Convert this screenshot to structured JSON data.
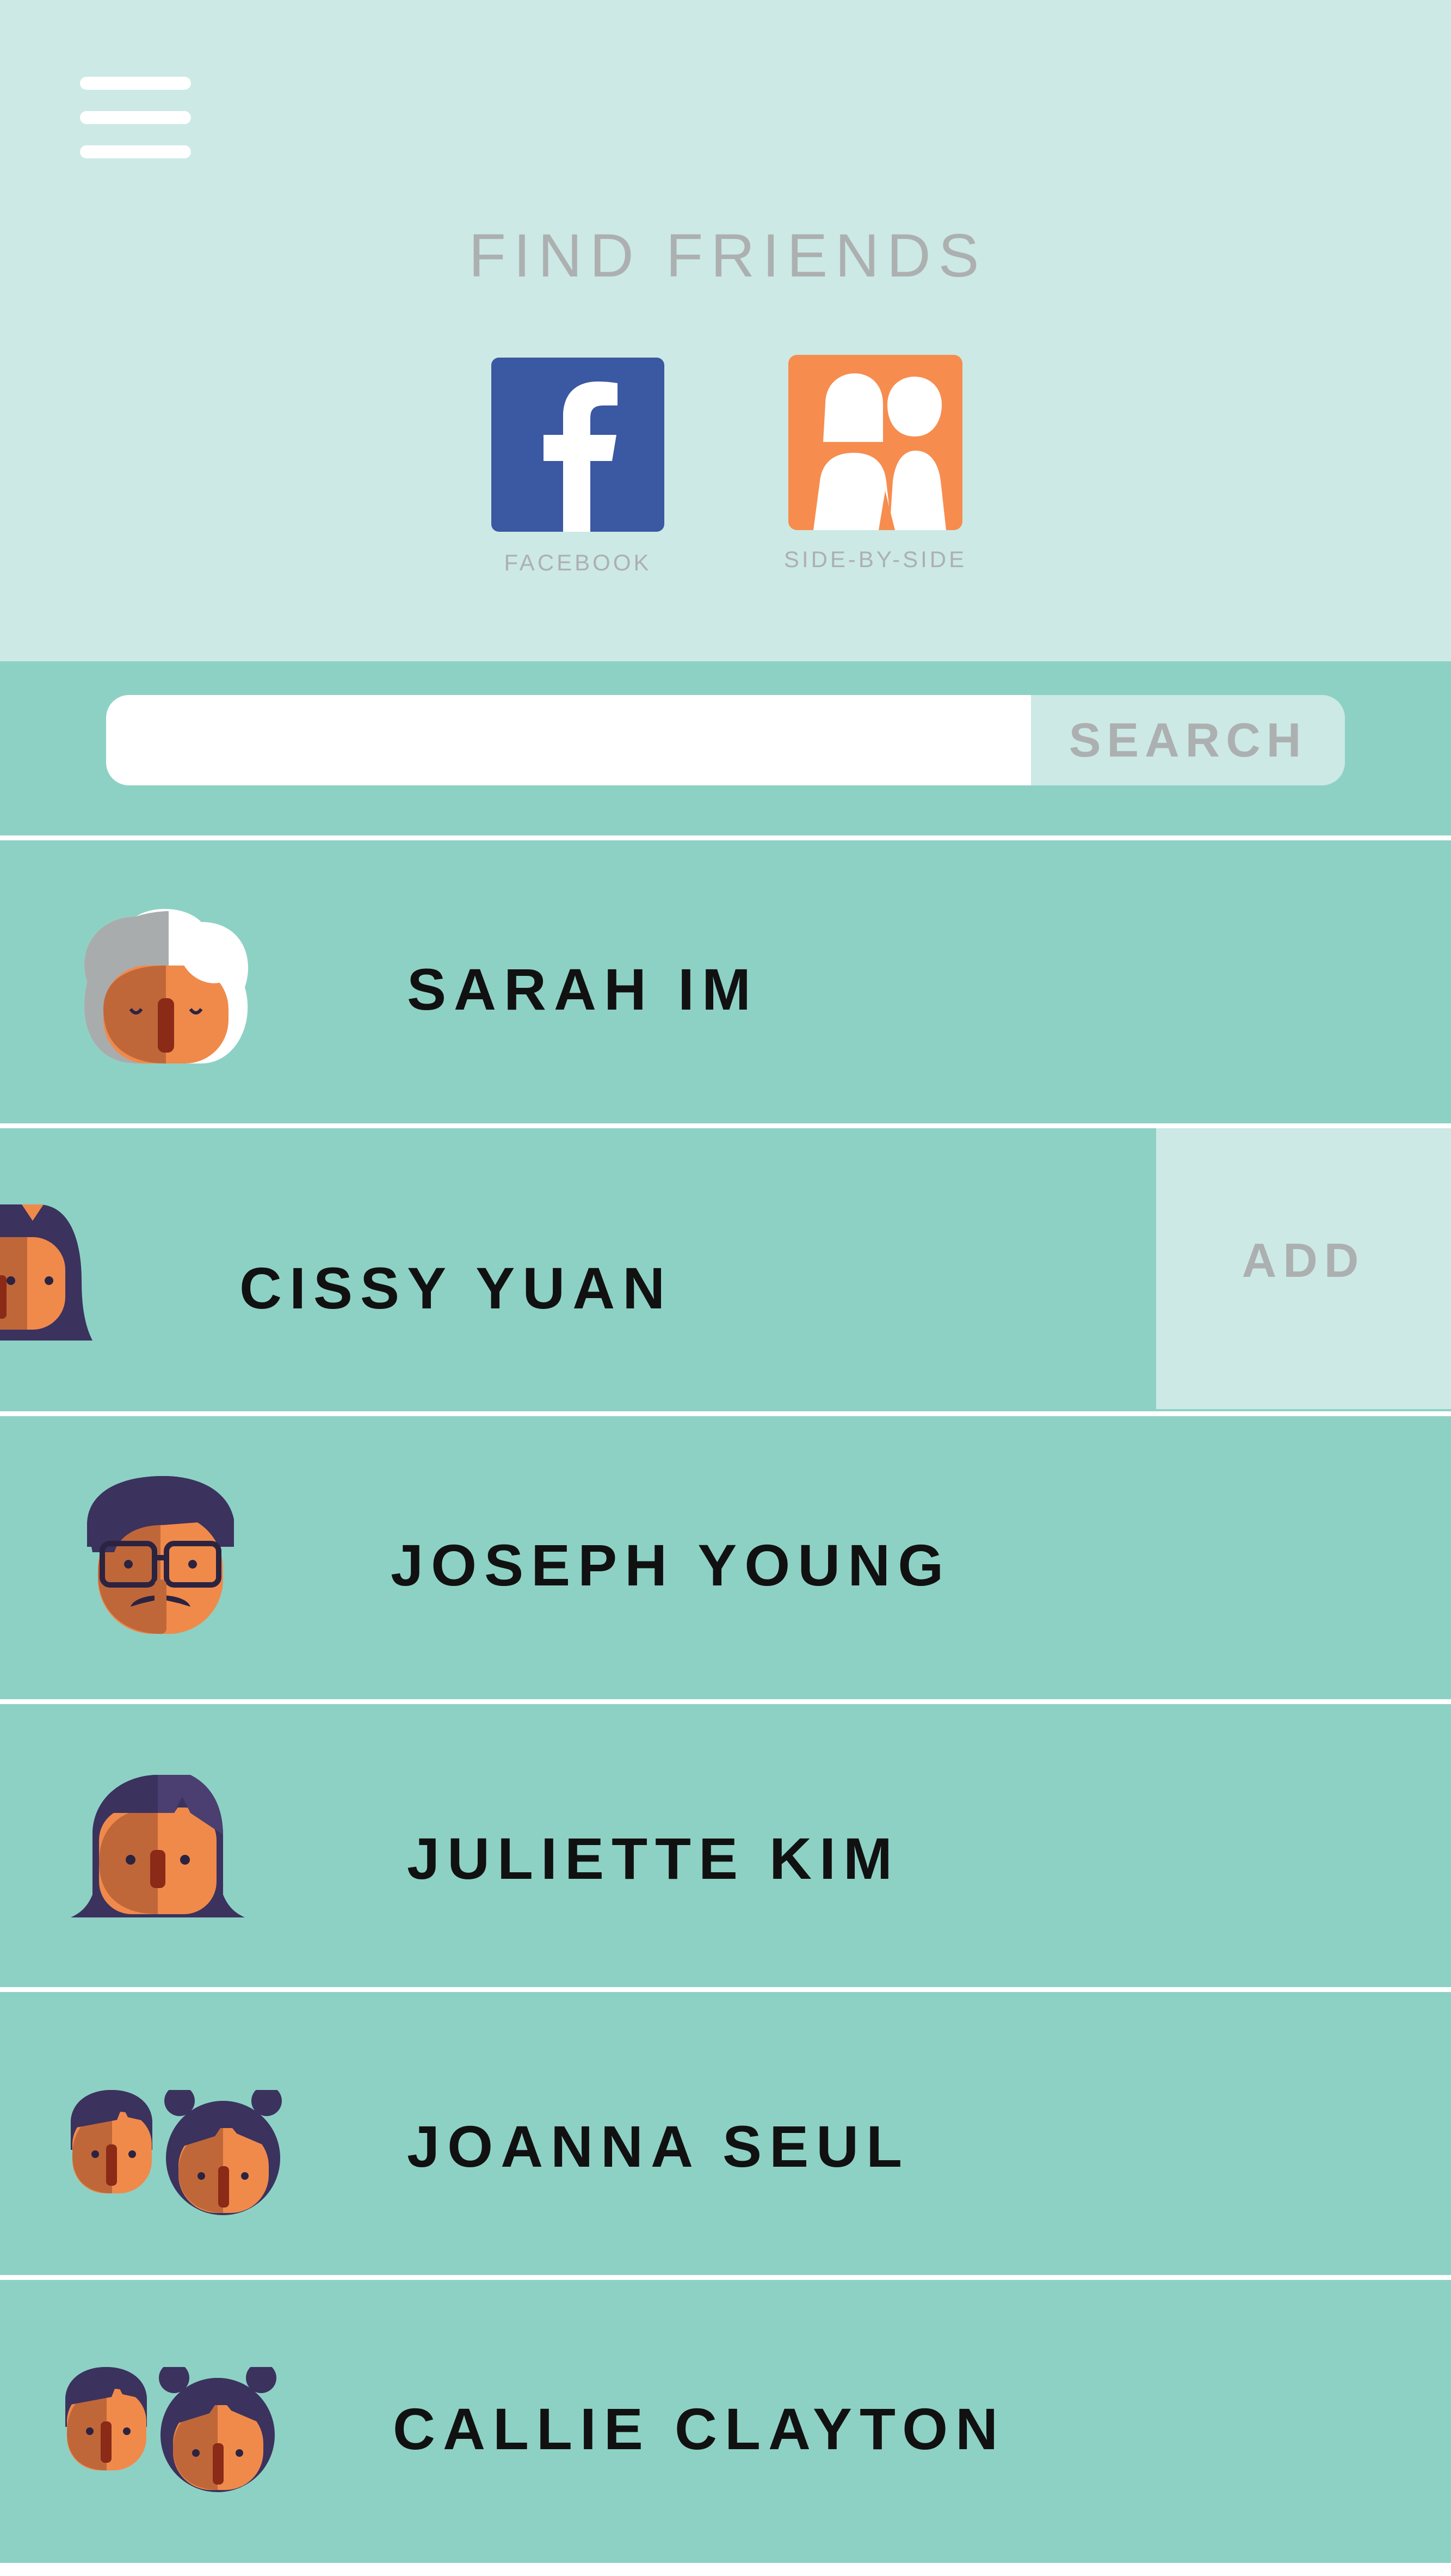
{
  "header": {
    "title": "FIND FRIENDS",
    "sources": [
      {
        "label": "FACEBOOK",
        "icon": "facebook-icon",
        "color": "#3b58a2"
      },
      {
        "label": "SIDE-BY-SIDE",
        "icon": "side-by-side-icon",
        "color": "#f78c4f"
      }
    ]
  },
  "search": {
    "placeholder": "",
    "button_label": "SEARCH"
  },
  "friends": [
    {
      "name": "SARAH IM",
      "avatar": "grandmother-avatar"
    },
    {
      "name": "CISSY YUAN",
      "avatar": "girl-avatar",
      "swipe_action": "ADD"
    },
    {
      "name": "JOSEPH YOUNG",
      "avatar": "man-glasses-mustache-avatar"
    },
    {
      "name": "JULIETTE KIM",
      "avatar": "woman-avatar"
    },
    {
      "name": "JOANNA SEUL",
      "avatar": "two-children-avatar"
    },
    {
      "name": "CALLIE CLAYTON",
      "avatar": "two-children-avatar"
    }
  ],
  "colors": {
    "header_bg": "#cce9e5",
    "row_bg": "#8dd1c5",
    "muted_text": "#adb0b0",
    "skin": "#f08a4b",
    "skin_shade": "#c0673a",
    "hair_dark": "#3b325e"
  }
}
